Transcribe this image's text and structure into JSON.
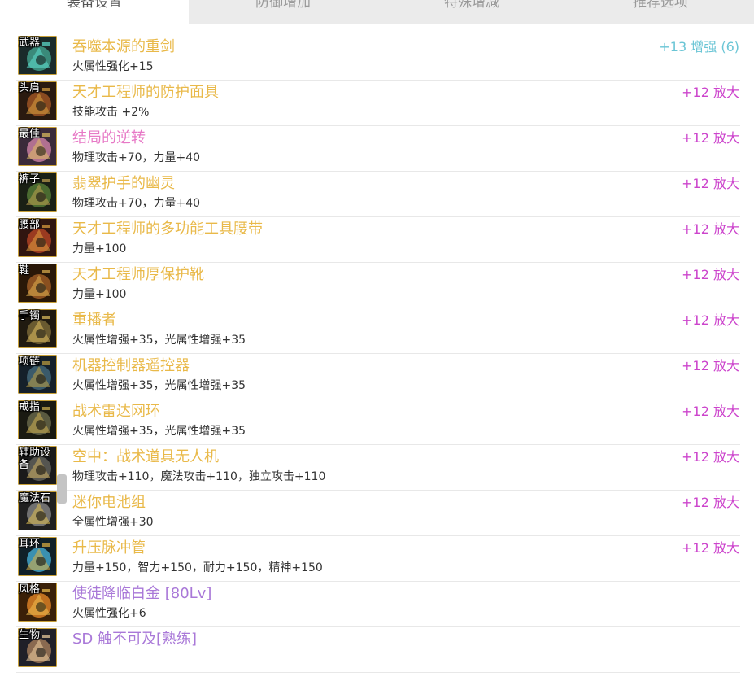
{
  "tabs": [
    {
      "label": "装备设置"
    },
    {
      "label": "防御增加"
    },
    {
      "label": "特殊增减"
    },
    {
      "label": "推荐选项"
    }
  ],
  "rows": [
    {
      "slot": "武器",
      "name": "吞噬本源的重剑",
      "name_color": "#e9b949",
      "stats": "火属性强化+15",
      "enh": "+13 增强 (6)",
      "enh_color": "#6ac5d5",
      "icon": "weapon-icon"
    },
    {
      "slot": "头肩",
      "name": "天才工程师的防护面具",
      "name_color": "#e9b949",
      "stats": "技能攻击 +2%",
      "enh": "+12 放大",
      "enh_color": "#cc44cc",
      "icon": "helmet-icon"
    },
    {
      "slot": "最佳",
      "name": "结局的逆转",
      "name_color": "#e779c6",
      "stats": "物理攻击+70，力量+40",
      "enh": "+12 放大",
      "enh_color": "#cc44cc",
      "icon": "top-armor-icon"
    },
    {
      "slot": "裤子",
      "name": "翡翠护手的幽灵",
      "name_color": "#e9b949",
      "stats": "物理攻击+70，力量+40",
      "enh": "+12 放大",
      "enh_color": "#cc44cc",
      "icon": "pants-icon"
    },
    {
      "slot": "腰部",
      "name": "天才工程师的多功能工具腰带",
      "name_color": "#e9b949",
      "stats": "力量+100",
      "enh": "+12 放大",
      "enh_color": "#cc44cc",
      "icon": "belt-icon"
    },
    {
      "slot": "鞋",
      "name": "天才工程师厚保护靴",
      "name_color": "#e9b949",
      "stats": "力量+100",
      "enh": "+12 放大",
      "enh_color": "#cc44cc",
      "icon": "boots-icon"
    },
    {
      "slot": "手镯",
      "name": "重播者",
      "name_color": "#e9b949",
      "stats": "火属性增强+35，光属性增强+35",
      "enh": "+12 放大",
      "enh_color": "#cc44cc",
      "icon": "bracelet-icon"
    },
    {
      "slot": "项链",
      "name": "机器控制器遥控器",
      "name_color": "#e9b949",
      "stats": "火属性增强+35，光属性增强+35",
      "enh": "+12 放大",
      "enh_color": "#cc44cc",
      "icon": "necklace-icon"
    },
    {
      "slot": "戒指",
      "name": "战术雷达网环",
      "name_color": "#e9b949",
      "stats": "火属性增强+35，光属性增强+35",
      "enh": "+12 放大",
      "enh_color": "#cc44cc",
      "icon": "ring-icon"
    },
    {
      "slot": "辅助设备",
      "name": "空中：战术道具无人机",
      "name_color": "#e9b949",
      "stats": "物理攻击+110，魔法攻击+110，独立攻击+110",
      "enh": "+12 放大",
      "enh_color": "#cc44cc",
      "icon": "support-device-icon"
    },
    {
      "slot": "魔法石",
      "name": "迷你电池组",
      "name_color": "#e9b949",
      "stats": "全属性增强+30",
      "enh": "+12 放大",
      "enh_color": "#cc44cc",
      "icon": "magic-stone-icon"
    },
    {
      "slot": "耳环",
      "name": "升压脉冲管",
      "name_color": "#e9b949",
      "stats": "力量+150，智力+150，耐力+150，精神+150",
      "enh": "+12 放大",
      "enh_color": "#cc44cc",
      "icon": "earring-icon"
    },
    {
      "slot": "风格",
      "name": "使徒降临白金 [80Lv]",
      "name_color": "#a978d8",
      "stats": "火属性强化+6",
      "enh": "",
      "enh_color": "#cc44cc",
      "icon": "title-icon"
    },
    {
      "slot": "生物",
      "name": "SD 触不可及[熟练]",
      "name_color": "#a978d8",
      "stats": "",
      "enh": "",
      "enh_color": "#cc44cc",
      "icon": "creature-icon"
    }
  ]
}
